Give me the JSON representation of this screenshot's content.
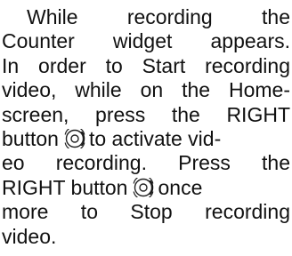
{
  "paragraph": {
    "line1": "While recording the",
    "line2": "Counter widget appears.",
    "line3": "In order to Start recording",
    "line4": "video, while on the Home-",
    "line5": "screen, press the RIGHT",
    "line6a": "button",
    "line6b": "to activate vid-",
    "line7": "eo recording. Press the",
    "line8a": "RIGHT button",
    "line8b": "once",
    "line9": "more to Stop recording",
    "line10": "video."
  },
  "icons": {
    "button_icon_1": "dpad-right-pressed-icon",
    "button_icon_2": "dpad-right-pressed-icon"
  },
  "colors": {
    "text": "#111111",
    "icon_outline": "#222222",
    "icon_pressed": "#111111"
  }
}
